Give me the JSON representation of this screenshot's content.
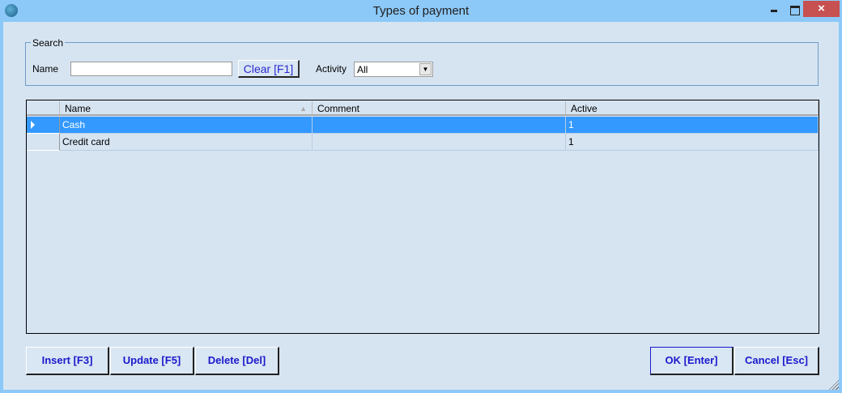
{
  "window": {
    "title": "Types of payment",
    "close_glyph": "×"
  },
  "search": {
    "legend": "Search",
    "name_label": "Name",
    "name_value": "",
    "clear_label": "Clear [F1]",
    "activity_label": "Activity",
    "activity_value": "All"
  },
  "grid": {
    "columns": [
      "Name",
      "Comment",
      "Active"
    ],
    "sort_column": "Name",
    "sort_direction": "ascending",
    "rows": [
      {
        "name": "Cash",
        "comment": "",
        "active": "1",
        "selected": true
      },
      {
        "name": "Credit card",
        "comment": "",
        "active": "1",
        "selected": false
      }
    ]
  },
  "buttons": {
    "insert": "Insert [F3]",
    "update": "Update [F5]",
    "delete": "Delete [Del]",
    "ok": "OK [Enter]",
    "cancel": "Cancel [Esc]"
  },
  "colors": {
    "selection": "#3399ff",
    "button_text": "#1a1acc",
    "titlebar": "#8cc8f8",
    "close": "#c75050"
  }
}
